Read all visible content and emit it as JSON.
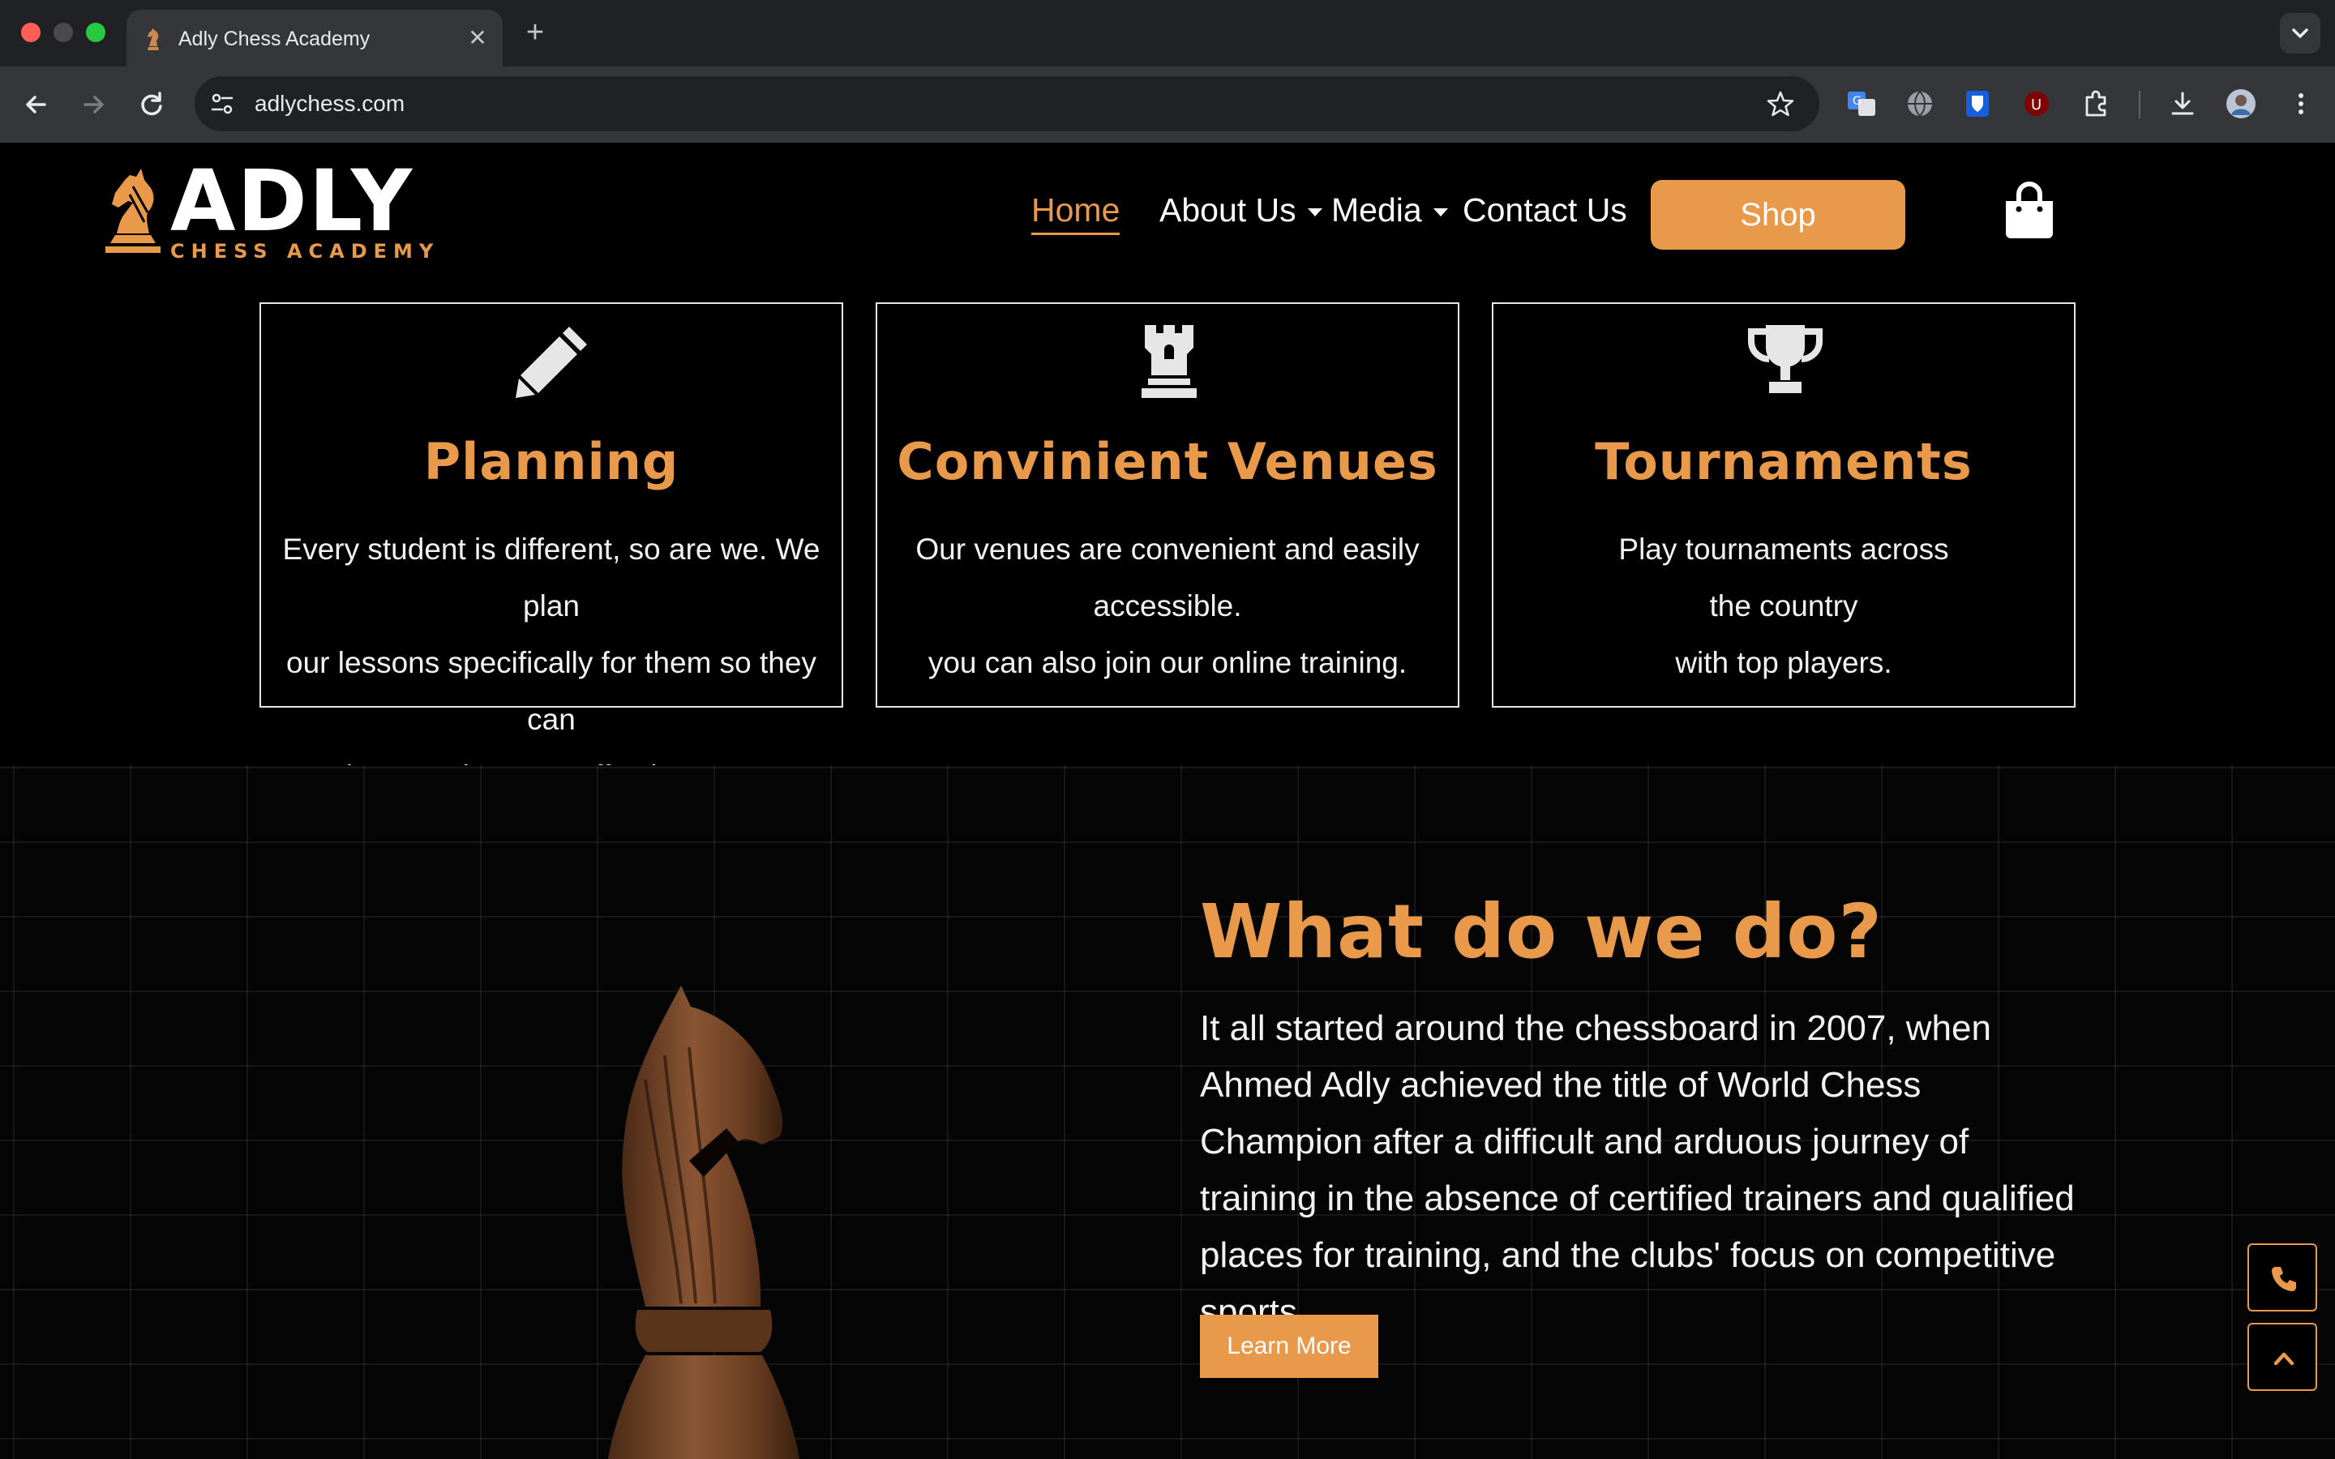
{
  "browser": {
    "tab_title": "Adly Chess Academy",
    "url": "adlychess.com"
  },
  "header": {
    "logo_word": "ADLY",
    "logo_sub": "CHESS ACADEMY",
    "nav": {
      "home": "Home",
      "about": "About Us",
      "media": "Media",
      "contact": "Contact Us"
    },
    "shop_label": "Shop"
  },
  "cards": [
    {
      "icon": "pencil-icon",
      "title": "Planning",
      "lines": [
        "Every student is different, so are we. We plan",
        "our lessons specifically for them so they can",
        "learn at the most effective way."
      ]
    },
    {
      "icon": "rook-icon",
      "title": "Convinient Venues",
      "lines": [
        "Our venues are convenient and easily",
        "accessible.",
        "you can also join our online training."
      ]
    },
    {
      "icon": "trophy-icon",
      "title": "Tournaments",
      "lines": [
        "Play tournaments across",
        "the country",
        "with top players."
      ]
    }
  ],
  "about": {
    "title": "What do we do?",
    "body": "It all started around the chessboard in 2007, when Ahmed Adly achieved the title of World Chess Champion after a difficult and arduous journey of training in the absence of certified trainers and qualified places for training, and the clubs' focus on competitive sports.",
    "button_label": "Learn More"
  },
  "colors": {
    "accent": "#e8994a",
    "background": "#000000"
  }
}
